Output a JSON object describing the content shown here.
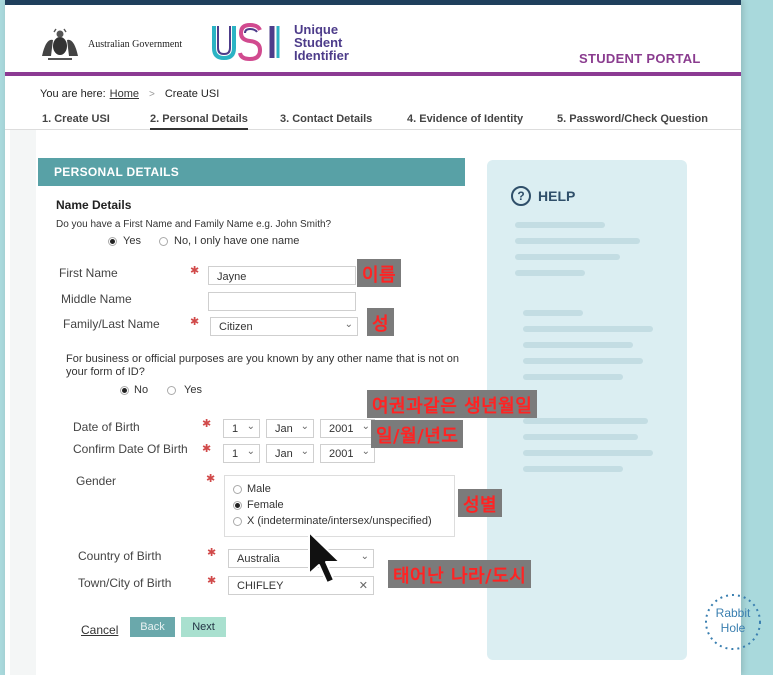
{
  "header": {
    "gov_name": "Australian Government",
    "usi_mark": "USI",
    "usi_words": [
      "Unique",
      "Student",
      "Identifier"
    ],
    "portal_title": "STUDENT PORTAL"
  },
  "breadcrumb": {
    "prefix": "You are here:",
    "home": "Home",
    "separator": ">",
    "current": "Create USI"
  },
  "steps": [
    {
      "label": "1. Create USI"
    },
    {
      "label": "2. Personal Details"
    },
    {
      "label": "3. Contact Details"
    },
    {
      "label": "4. Evidence of Identity"
    },
    {
      "label": "5. Password/Check Question"
    }
  ],
  "section": {
    "title": "PERSONAL DETAILS"
  },
  "form": {
    "name_heading": "Name Details",
    "name_question": "Do you have a First Name and Family Name e.g. John Smith?",
    "name_yes": "Yes",
    "name_no": "No, I only have one name",
    "first_name_label": "First Name",
    "first_name_value": "Jayne",
    "middle_name_label": "Middle Name",
    "middle_name_value": "",
    "family_name_label": "Family/Last Name",
    "family_name_value": "Citizen",
    "other_name_question_1": "For business or official purposes are you known by any other name that is not on",
    "other_name_question_2": "your form of ID?",
    "other_no": "No",
    "other_yes": "Yes",
    "dob_label": "Date of Birth",
    "confirm_dob_label": "Confirm Date Of Birth",
    "dob_day": "1",
    "dob_month": "Jan",
    "dob_year": "2001",
    "confirm_day": "1",
    "confirm_month": "Jan",
    "confirm_year": "2001",
    "gender_label": "Gender",
    "gender_male": "Male",
    "gender_female": "Female",
    "gender_x": "X (indeterminate/intersex/unspecified)",
    "country_label": "Country of Birth",
    "country_value": "Australia",
    "town_label": "Town/City of Birth",
    "town_value": "CHIFLEY",
    "town_clear": "✕",
    "required_mark": "✱",
    "chevron": "⌄"
  },
  "buttons": {
    "cancel": "Cancel",
    "back": "Back",
    "next": "Next"
  },
  "help": {
    "icon": "?",
    "title": "HELP"
  },
  "overlays": {
    "first_name": "이름",
    "family_name": "성",
    "passport_dob": "여권과같은 생년월일",
    "dob_order": "일/월/년도",
    "gender": "성별",
    "birth_place": "태어난 나라/도시"
  },
  "watermark": {
    "line1": "Rabbit",
    "line2": "Hole"
  },
  "colors": {
    "top_bar": "#1f3f5c",
    "purple_accent": "#8c3a93",
    "section_teal": "#58a1a6",
    "help_panel": "#dbeef2",
    "required_red": "#d14a4a",
    "overlay_text_red": "#ff2323",
    "overlay_bg_gray": "#7b7b7b"
  },
  "icons": {
    "crest": "coat-of-arms-icon",
    "cursor": "mouse-pointer-icon",
    "help": "question-circle-icon",
    "clear": "clear-x-icon",
    "chevron": "chevron-down-icon"
  }
}
